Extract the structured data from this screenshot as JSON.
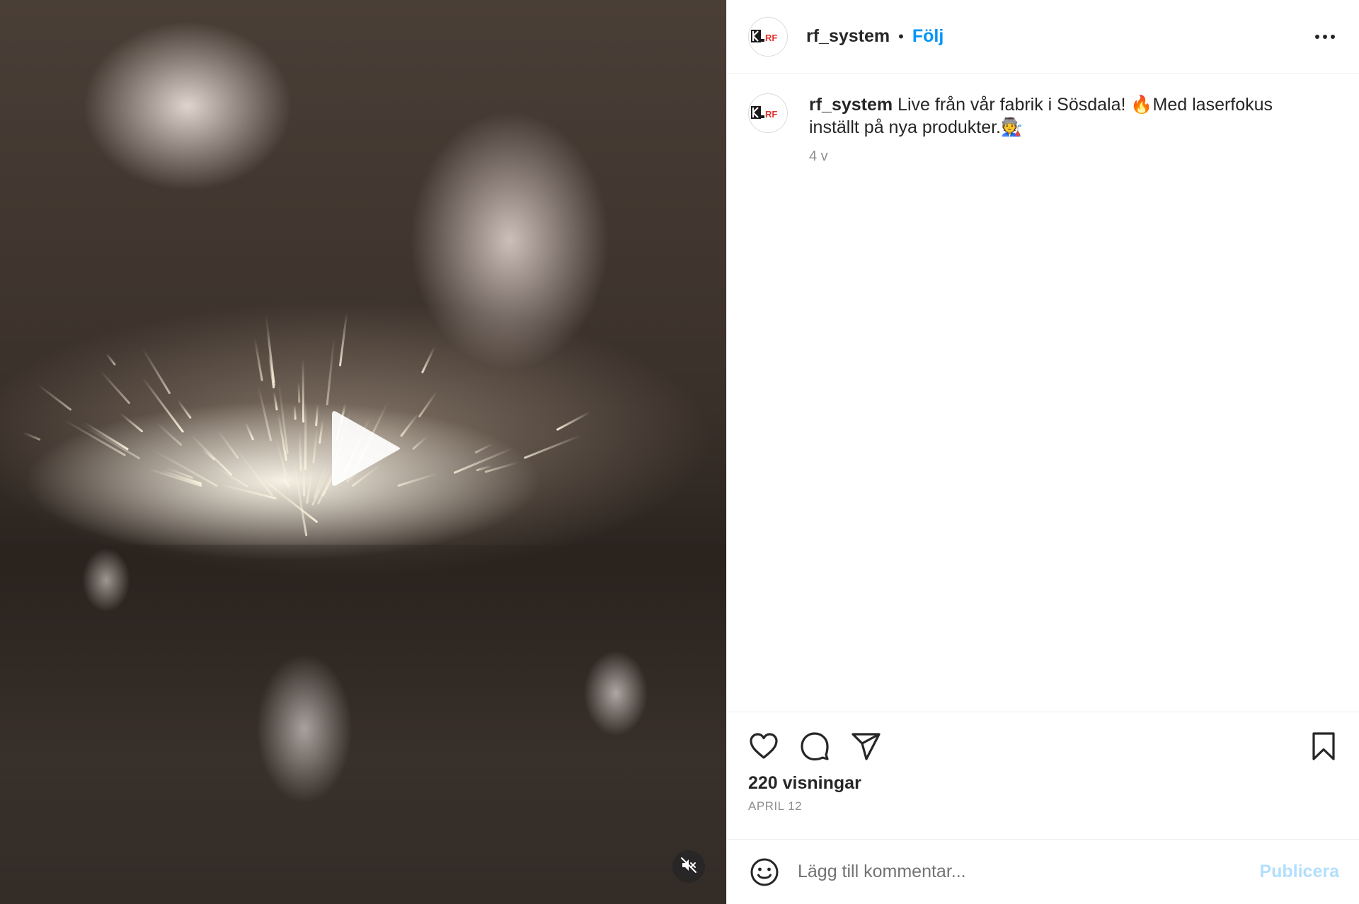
{
  "post": {
    "username": "rf_system",
    "separator": "•",
    "follow_label": "Följ",
    "avatar_text": "RF"
  },
  "caption": {
    "username": "rf_system",
    "text": " Live från vår fabrik i Sösdala! 🔥Med laserfokus inställt på nya produkter.🧑‍🏭",
    "time_ago": "4 v"
  },
  "stats": {
    "views": "220 visningar",
    "date": "APRIL 12"
  },
  "comment": {
    "placeholder": "Lägg till kommentar...",
    "publish_label": "Publicera"
  },
  "colors": {
    "accent": "#0095f6",
    "publish_disabled": "#b2dffc",
    "text": "#262626",
    "muted": "#8e8e8e",
    "logo_red": "#e0312f"
  },
  "icons": {
    "play": "play-icon",
    "mute": "muted-speaker-icon",
    "more": "more-options-icon",
    "like": "heart-icon",
    "comment": "comment-bubble-icon",
    "share": "paper-plane-icon",
    "save": "bookmark-icon",
    "emoji": "emoji-smiley-icon"
  }
}
